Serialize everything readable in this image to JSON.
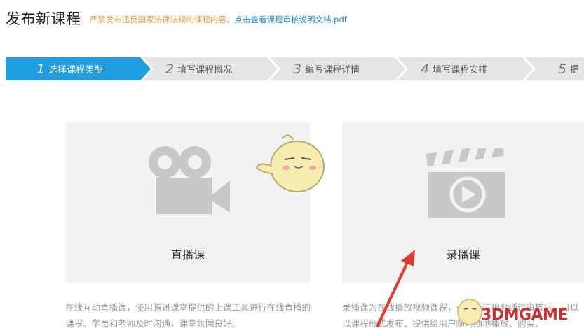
{
  "header": {
    "title": "发布新课程",
    "notice_warning": "严禁发布违反国家法律法规的课程内容，",
    "notice_link": "点击查看课程审核说明文档.pdf"
  },
  "steps": [
    {
      "num": "1",
      "label": "选择课程类型",
      "active": true
    },
    {
      "num": "2",
      "label": "填写课程概况",
      "active": false
    },
    {
      "num": "3",
      "label": "编写课程详情",
      "active": false
    },
    {
      "num": "4",
      "label": "填写课程安排",
      "active": false
    },
    {
      "num": "5",
      "label": "提",
      "active": false
    }
  ],
  "cards": {
    "live": {
      "title": "直播课",
      "icon": "video-camera-icon",
      "desc": "在线互动直播课，使用腾讯课堂提供的上课工具进行在线直播的课程。学员和老师及时沟通，课堂氛围良好。"
    },
    "recorded": {
      "title": "录播课",
      "icon": "clapperboard-play-icon",
      "desc": "录播课为在线播放视频课程，一旦上传视频通过审核后，可以以课程形式发布，提供给用户随时随地播放、购买、"
    }
  },
  "colors": {
    "active_step": "#1e9de1",
    "inactive_step": "#e5e5e5",
    "card_bg": "#f2f2f2",
    "icon_gray": "#c8c8c8",
    "warning": "#e89d3c",
    "link": "#1e8fd6",
    "arrow_red": "#e03a32"
  },
  "watermark": {
    "text": "3DMGAME"
  }
}
